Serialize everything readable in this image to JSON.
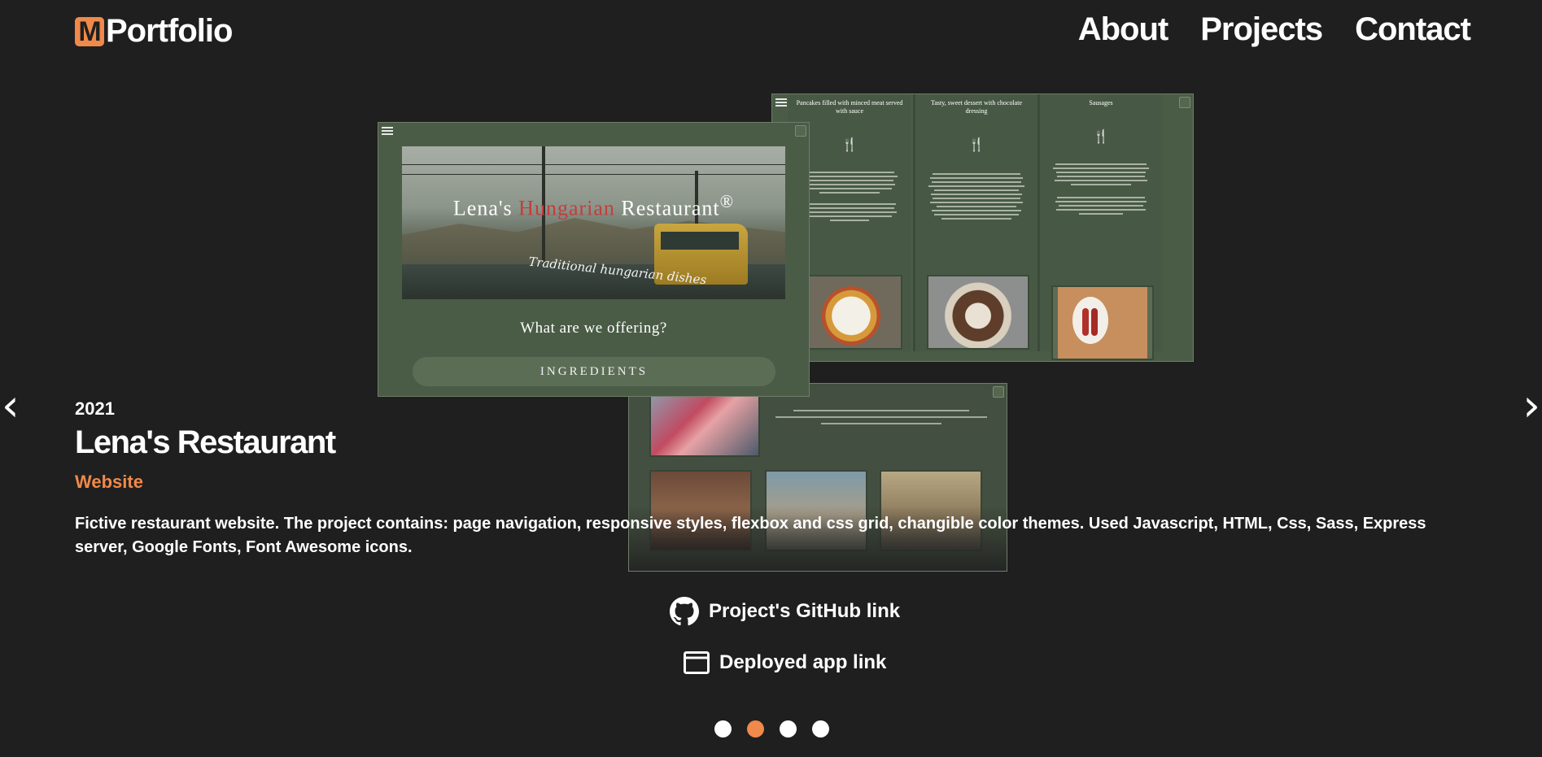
{
  "header": {
    "logo_mark": "M",
    "logo_text": "Portfolio",
    "nav": [
      {
        "label": "About"
      },
      {
        "label": "Projects"
      },
      {
        "label": "Contact"
      }
    ]
  },
  "preview": {
    "main": {
      "title_part1": "Lena's ",
      "title_part2": "Hungarian",
      "title_part3": " Restaurant",
      "title_mark": "®",
      "subtitle": "Traditional hungarian dishes",
      "section_title": "What are we offering?",
      "button": "INGREDIENTS"
    },
    "menu": [
      {
        "title": "Pancakes filled with minced meat served with sauce"
      },
      {
        "title": "Tasty, sweet dessert with chocolate dressing"
      },
      {
        "title": "Sausages"
      }
    ]
  },
  "project": {
    "year": "2021",
    "title": "Lena's Restaurant",
    "type": "Website",
    "description": "Fictive restaurant website. The project contains: page navigation, responsive styles, flexbox and css grid, changible color themes. Used Javascript, HTML, Css, Sass, Express server, Google Fonts, Font Awesome icons.",
    "github_link_label": "Project's GitHub link",
    "app_link_label": "Deployed app link"
  },
  "carousel": {
    "prev_label": "‹",
    "next_label": "›",
    "slide_count": 4,
    "active_index": 1
  },
  "colors": {
    "background": "#1f1f1f",
    "accent": "#f0894a"
  },
  "icons": {
    "github": "github-icon",
    "browser": "browser-window-icon"
  }
}
